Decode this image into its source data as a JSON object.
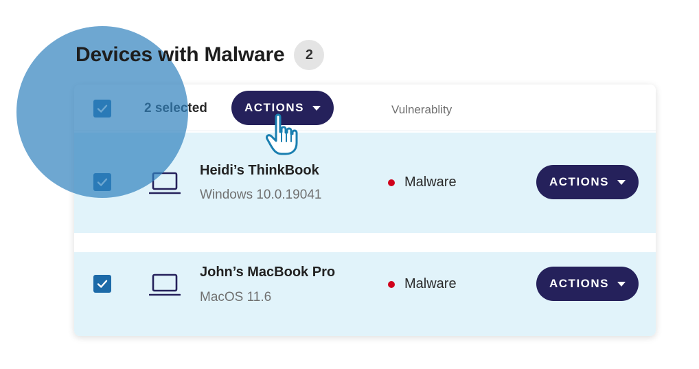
{
  "page": {
    "title": "Devices with Malware",
    "count": "2"
  },
  "toolbar": {
    "selected_text": "2 selected",
    "actions_label": "ACTIONS",
    "column_vulnerability": "Vulnerablity"
  },
  "devices": [
    {
      "name": "Heidi’s ThinkBook",
      "os": "Windows 10.0.19041",
      "status": "Malware",
      "actions_label": "ACTIONS",
      "checked": true
    },
    {
      "name": "John’s MacBook Pro",
      "os": "MacOS 11.6",
      "status": "Malware",
      "actions_label": "ACTIONS",
      "checked": true
    }
  ],
  "icons": {
    "checkbox": "checkmark-icon",
    "device": "laptop-icon",
    "caret": "caret-down-icon",
    "pointer": "hand-pointer-icon"
  },
  "colors": {
    "primary_button": "#25215b",
    "checkbox": "#1c6aa8",
    "row_selected": "#e1f3fa",
    "status_malware": "#d0021b",
    "highlight": "#3082be"
  }
}
